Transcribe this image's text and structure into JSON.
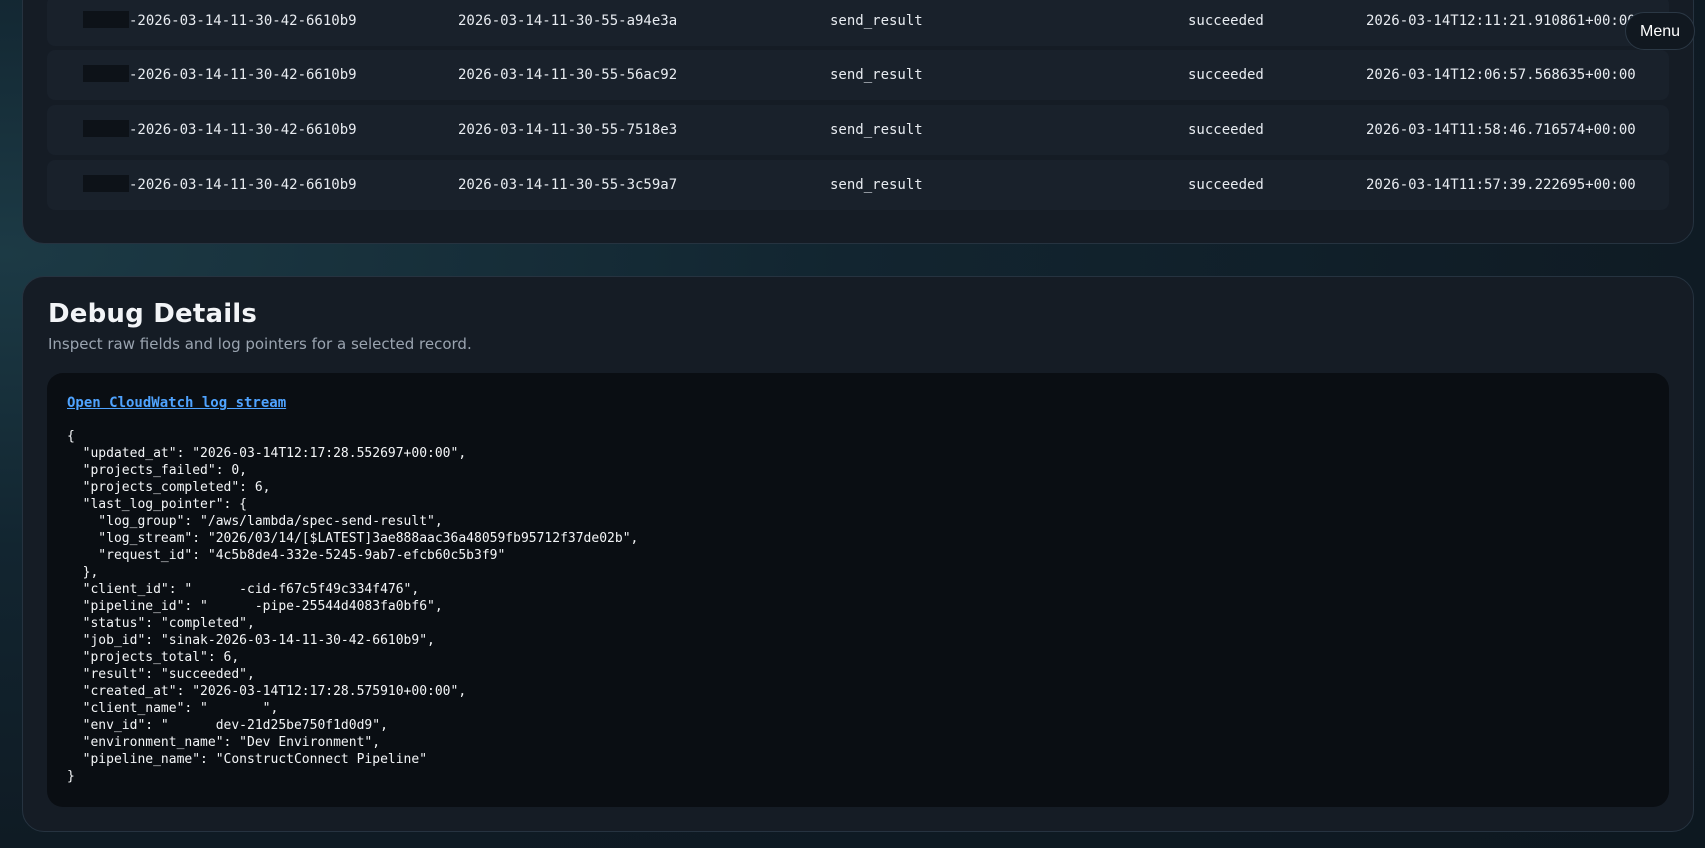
{
  "menu": {
    "label": "Menu"
  },
  "records": [
    {
      "job_id": "-2026-03-14-11-30-42-6610b9",
      "run_id": "2026-03-14-11-30-55-a94e3a",
      "step": "send_result",
      "result": "succeeded",
      "timestamp": "2026-03-14T12:11:21.910861+00:00"
    },
    {
      "job_id": "-2026-03-14-11-30-42-6610b9",
      "run_id": "2026-03-14-11-30-55-56ac92",
      "step": "send_result",
      "result": "succeeded",
      "timestamp": "2026-03-14T12:06:57.568635+00:00"
    },
    {
      "job_id": "-2026-03-14-11-30-42-6610b9",
      "run_id": "2026-03-14-11-30-55-7518e3",
      "step": "send_result",
      "result": "succeeded",
      "timestamp": "2026-03-14T11:58:46.716574+00:00"
    },
    {
      "job_id": "-2026-03-14-11-30-42-6610b9",
      "run_id": "2026-03-14-11-30-55-3c59a7",
      "step": "send_result",
      "result": "succeeded",
      "timestamp": "2026-03-14T11:57:39.222695+00:00"
    }
  ],
  "debug": {
    "title": "Debug Details",
    "subtitle": "Inspect raw fields and log pointers for a selected record.",
    "log_link_label": "Open CloudWatch log stream",
    "json_lines": [
      "{",
      "  \"updated_at\": \"2026-03-14T12:17:28.552697+00:00\",",
      "  \"projects_failed\": 0,",
      "  \"projects_completed\": 6,",
      "  \"last_log_pointer\": {",
      "    \"log_group\": \"/aws/lambda/spec-send-result\",",
      "    \"log_stream\": \"2026/03/14/[$LATEST]3ae888aac36a48059fb95712f37de02b\",",
      "    \"request_id\": \"4c5b8de4-332e-5245-9ab7-efcb60c5b3f9\"",
      "  },",
      "  \"client_id\": \"      -cid-f67c5f49c334f476\",",
      "  \"pipeline_id\": \"      -pipe-25544d4083fa0bf6\",",
      "  \"status\": \"completed\",",
      "  \"job_id\": \"sinak-2026-03-14-11-30-42-6610b9\",",
      "  \"projects_total\": 6,",
      "  \"result\": \"succeeded\",",
      "  \"created_at\": \"2026-03-14T12:17:28.575910+00:00\",",
      "  \"client_name\": \"       \",",
      "  \"env_id\": \"      dev-21d25be750f1d0d9\",",
      "  \"environment_name\": \"Dev Environment\",",
      "  \"pipeline_name\": \"ConstructConnect Pipeline\"",
      "}"
    ]
  }
}
